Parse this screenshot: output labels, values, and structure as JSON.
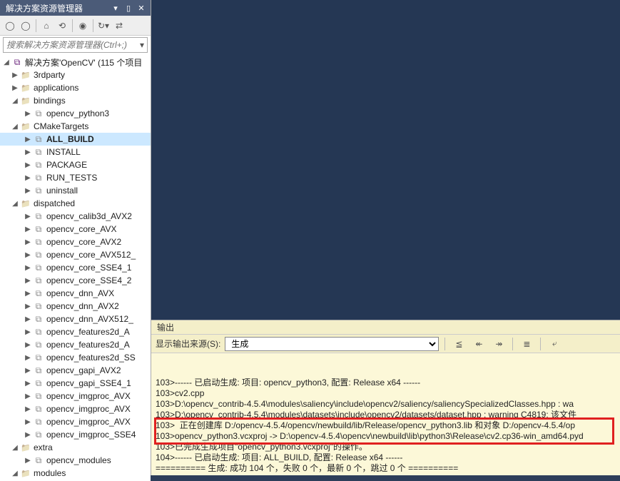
{
  "solutionExplorer": {
    "title": "解决方案资源管理器",
    "searchPlaceholder": "搜索解决方案资源管理器(Ctrl+;)",
    "root": "解决方案'OpenCV' (115 个项目",
    "nodes": [
      {
        "indent": 0,
        "exp": "▶",
        "type": "folder",
        "label": "3rdparty"
      },
      {
        "indent": 0,
        "exp": "▶",
        "type": "folder",
        "label": "applications"
      },
      {
        "indent": 0,
        "exp": "◢",
        "type": "folder",
        "label": "bindings"
      },
      {
        "indent": 1,
        "exp": "▶",
        "type": "proj",
        "label": "opencv_python3"
      },
      {
        "indent": 0,
        "exp": "◢",
        "type": "folder",
        "label": "CMakeTargets"
      },
      {
        "indent": 1,
        "exp": "▶",
        "type": "proj",
        "label": "ALL_BUILD",
        "bold": true
      },
      {
        "indent": 1,
        "exp": "▶",
        "type": "proj",
        "label": "INSTALL"
      },
      {
        "indent": 1,
        "exp": "▶",
        "type": "proj",
        "label": "PACKAGE"
      },
      {
        "indent": 1,
        "exp": "▶",
        "type": "proj",
        "label": "RUN_TESTS"
      },
      {
        "indent": 1,
        "exp": "▶",
        "type": "proj",
        "label": "uninstall"
      },
      {
        "indent": 0,
        "exp": "◢",
        "type": "folder",
        "label": "dispatched"
      },
      {
        "indent": 1,
        "exp": "▶",
        "type": "proj",
        "label": "opencv_calib3d_AVX2"
      },
      {
        "indent": 1,
        "exp": "▶",
        "type": "proj",
        "label": "opencv_core_AVX"
      },
      {
        "indent": 1,
        "exp": "▶",
        "type": "proj",
        "label": "opencv_core_AVX2"
      },
      {
        "indent": 1,
        "exp": "▶",
        "type": "proj",
        "label": "opencv_core_AVX512_"
      },
      {
        "indent": 1,
        "exp": "▶",
        "type": "proj",
        "label": "opencv_core_SSE4_1"
      },
      {
        "indent": 1,
        "exp": "▶",
        "type": "proj",
        "label": "opencv_core_SSE4_2"
      },
      {
        "indent": 1,
        "exp": "▶",
        "type": "proj",
        "label": "opencv_dnn_AVX"
      },
      {
        "indent": 1,
        "exp": "▶",
        "type": "proj",
        "label": "opencv_dnn_AVX2"
      },
      {
        "indent": 1,
        "exp": "▶",
        "type": "proj",
        "label": "opencv_dnn_AVX512_"
      },
      {
        "indent": 1,
        "exp": "▶",
        "type": "proj",
        "label": "opencv_features2d_A"
      },
      {
        "indent": 1,
        "exp": "▶",
        "type": "proj",
        "label": "opencv_features2d_A"
      },
      {
        "indent": 1,
        "exp": "▶",
        "type": "proj",
        "label": "opencv_features2d_SS"
      },
      {
        "indent": 1,
        "exp": "▶",
        "type": "proj",
        "label": "opencv_gapi_AVX2"
      },
      {
        "indent": 1,
        "exp": "▶",
        "type": "proj",
        "label": "opencv_gapi_SSE4_1"
      },
      {
        "indent": 1,
        "exp": "▶",
        "type": "proj",
        "label": "opencv_imgproc_AVX"
      },
      {
        "indent": 1,
        "exp": "▶",
        "type": "proj",
        "label": "opencv_imgproc_AVX"
      },
      {
        "indent": 1,
        "exp": "▶",
        "type": "proj",
        "label": "opencv_imgproc_AVX"
      },
      {
        "indent": 1,
        "exp": "▶",
        "type": "proj",
        "label": "opencv_imgproc_SSE4"
      },
      {
        "indent": 0,
        "exp": "◢",
        "type": "folder",
        "label": "extra"
      },
      {
        "indent": 1,
        "exp": "▶",
        "type": "proj",
        "label": "opencv_modules"
      },
      {
        "indent": 0,
        "exp": "◢",
        "type": "folder",
        "label": "modules"
      }
    ]
  },
  "output": {
    "panelTitle": "输出",
    "sourceLabel": "显示输出来源(S):",
    "sourceSelected": "生成",
    "lines": [
      "103>------ 已启动生成: 项目: opencv_python3, 配置: Release x64 ------",
      "103>cv2.cpp",
      "103>D:\\opencv_contrib-4.5.4\\modules\\saliency\\include\\opencv2/saliency/saliencySpecializedClasses.hpp : wa",
      "103>D:\\opencv_contrib-4.5.4\\modules\\datasets\\include\\opencv2/datasets/dataset.hpp : warning C4819: 该文件",
      "103>  正在创建库 D:/opencv-4.5.4/opencv/newbuild/lib/Release/opencv_python3.lib 和对象 D:/opencv-4.5.4/op",
      "103>opencv_python3.vcxproj -> D:\\opencv-4.5.4\\opencv\\newbuild\\lib\\python3\\Release\\cv2.cp36-win_amd64.pyd",
      "103>已完成生成项目\"opencv_python3.vcxproj\"的操作。",
      "104>------ 已启动生成: 项目: ALL_BUILD, 配置: Release x64 ------",
      "========== 生成: 成功 104 个，失败 0 个，最新 0 个，跳过 0 个 =========="
    ]
  }
}
